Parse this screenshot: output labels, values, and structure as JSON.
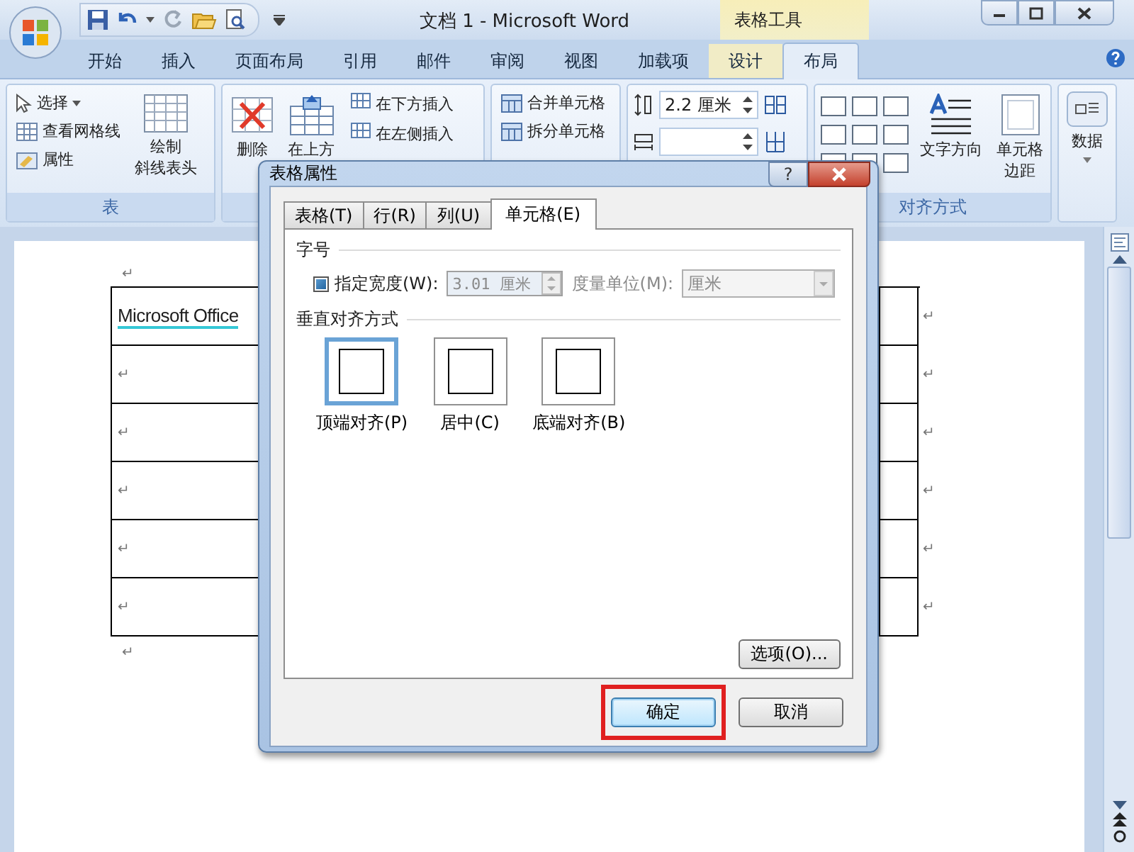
{
  "window": {
    "title": "文档 1 - Microsoft Word",
    "context_group": "表格工具"
  },
  "ribbon_tabs": [
    {
      "label": "开始",
      "selected": false,
      "contextual": false
    },
    {
      "label": "插入",
      "selected": false,
      "contextual": false
    },
    {
      "label": "页面布局",
      "selected": false,
      "contextual": false
    },
    {
      "label": "引用",
      "selected": false,
      "contextual": false
    },
    {
      "label": "邮件",
      "selected": false,
      "contextual": false
    },
    {
      "label": "审阅",
      "selected": false,
      "contextual": false
    },
    {
      "label": "视图",
      "selected": false,
      "contextual": false
    },
    {
      "label": "加载项",
      "selected": false,
      "contextual": false
    },
    {
      "label": "设计",
      "selected": false,
      "contextual": true
    },
    {
      "label": "布局",
      "selected": true,
      "contextual": true
    }
  ],
  "ribbon": {
    "table_group": {
      "label": "表",
      "small_buttons": [
        {
          "label": "选择",
          "dropdown": true
        },
        {
          "label": "查看网格线",
          "dropdown": false
        },
        {
          "label": "属性",
          "dropdown": false
        }
      ],
      "big_button_lines": [
        "绘制",
        "斜线表头"
      ]
    },
    "rows_columns_group": {
      "big_buttons": [
        "删除",
        "在上方"
      ],
      "small_buttons": [
        "在下方插入",
        "在左侧插入"
      ]
    },
    "merge_group": {
      "small_buttons": [
        "合并单元格",
        "拆分单元格"
      ]
    },
    "cell_size_group": {
      "height_field": "2.2 厘米"
    },
    "alignment_group": {
      "label": "对齐方式",
      "big_buttons": [
        {
          "lines": [
            "文字方向"
          ]
        },
        {
          "lines": [
            "单元格",
            "边距"
          ]
        }
      ]
    },
    "data_group": {
      "button": "数据"
    }
  },
  "document": {
    "before_table": "↵",
    "after_table": "↵",
    "table_rows": [
      {
        "first_cell": "Microsoft Office",
        "flagged": true,
        "end_mark": "↵"
      },
      {
        "first_cell": "↵",
        "end_mark": "↵"
      },
      {
        "first_cell": "↵",
        "end_mark": "↵"
      },
      {
        "first_cell": "↵",
        "end_mark": "↵"
      },
      {
        "first_cell": "↵",
        "end_mark": "↵"
      },
      {
        "first_cell": "↵",
        "end_mark": "↵"
      }
    ]
  },
  "dialog": {
    "title": "表格属性",
    "help": "?",
    "tabs": [
      {
        "label": "表格(T)",
        "selected": false
      },
      {
        "label": "行(R)",
        "selected": false
      },
      {
        "label": "列(U)",
        "selected": false
      },
      {
        "label": "单元格(E)",
        "selected": true
      }
    ],
    "size_section": "字号",
    "width_checkbox": {
      "label": "指定宽度(W):",
      "checked": true
    },
    "width_field": {
      "value": "3.01 厘米",
      "disabled": true
    },
    "unit_label": "度量单位(M):",
    "unit_select": {
      "value": "厘米",
      "disabled": true
    },
    "valign_section": "垂直对齐方式",
    "valign_options": [
      {
        "label": "顶端对齐(P)",
        "selected": true
      },
      {
        "label": "居中(C)",
        "selected": false
      },
      {
        "label": "底端对齐(B)",
        "selected": false
      }
    ],
    "options_button": "选项(O)...",
    "buttons": [
      {
        "label": "确定",
        "default": true,
        "highlighted": true
      },
      {
        "label": "取消",
        "default": false,
        "highlighted": false
      }
    ]
  }
}
